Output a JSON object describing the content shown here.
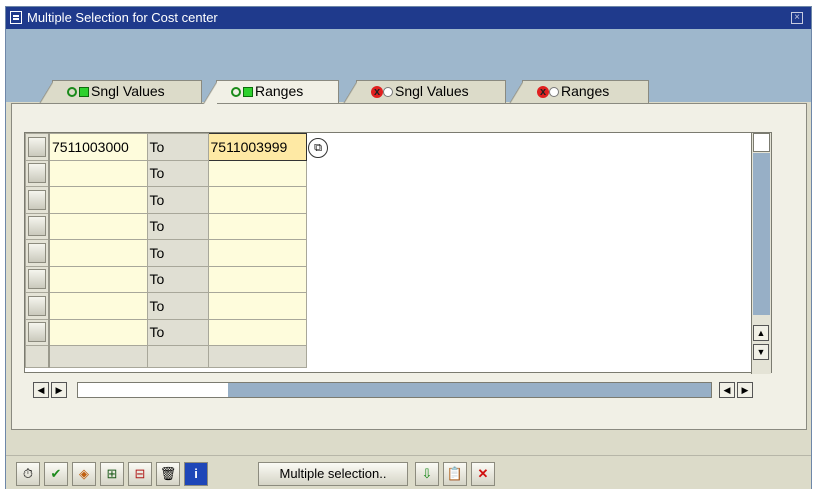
{
  "window": {
    "title": "Multiple Selection for Cost center"
  },
  "tabs": [
    {
      "label": "Sngl Values",
      "icon": "include-green-icon"
    },
    {
      "label": "Ranges",
      "icon": "include-green-icon",
      "active": true
    },
    {
      "label": "Sngl Values",
      "icon": "exclude-red-icon"
    },
    {
      "label": "Ranges",
      "icon": "exclude-red-icon"
    }
  ],
  "grid": {
    "rows": [
      {
        "low": "7511003000",
        "option": "To",
        "high": "7511003999"
      },
      {
        "low": "",
        "option": "To",
        "high": ""
      },
      {
        "low": "",
        "option": "To",
        "high": ""
      },
      {
        "low": "",
        "option": "To",
        "high": ""
      },
      {
        "low": "",
        "option": "To",
        "high": ""
      },
      {
        "low": "",
        "option": "To",
        "high": ""
      },
      {
        "low": "",
        "option": "To",
        "high": ""
      },
      {
        "low": "",
        "option": "To",
        "high": ""
      }
    ]
  },
  "toolbar": {
    "multiple_selection_label": "Multiple selection.."
  },
  "icons": [
    "execute-icon",
    "check-icon",
    "options-icon",
    "insert-line-icon",
    "delete-line-icon",
    "trash-icon",
    "info-icon",
    "import-icon",
    "paste-icon",
    "cancel-icon"
  ]
}
